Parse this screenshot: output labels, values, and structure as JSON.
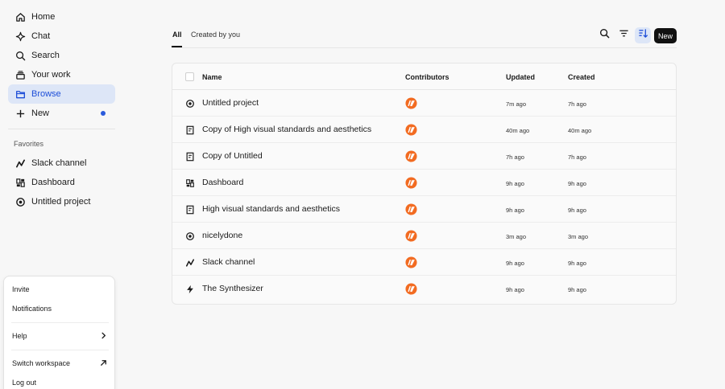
{
  "sidebar": {
    "nav": [
      {
        "label": "Home",
        "icon": "home-icon"
      },
      {
        "label": "Chat",
        "icon": "sparkle-icon"
      },
      {
        "label": "Search",
        "icon": "search-icon"
      },
      {
        "label": "Your work",
        "icon": "stack-icon"
      },
      {
        "label": "Browse",
        "icon": "folder-icon",
        "active": true
      },
      {
        "label": "New",
        "icon": "plus-icon",
        "has_dot": true
      }
    ],
    "favorites_heading": "Favorites",
    "favorites": [
      {
        "label": "Slack channel",
        "icon": "zigzag-icon"
      },
      {
        "label": "Dashboard",
        "icon": "dashboard-icon"
      },
      {
        "label": "Untitled project",
        "icon": "target-icon"
      }
    ]
  },
  "popup_menu": {
    "items": [
      {
        "label": "Invite"
      },
      {
        "label": "Notifications"
      },
      {
        "label": "Help",
        "trailing_icon": "chevron-right-icon"
      },
      {
        "label": "Switch workspace",
        "trailing_icon": "arrow-up-right-icon"
      },
      {
        "label": "Log out"
      }
    ]
  },
  "tabs": [
    {
      "label": "All",
      "active": true
    },
    {
      "label": "Created by you"
    }
  ],
  "toolbar": {
    "search_icon": "search-icon",
    "filter_icon": "filter-icon",
    "sort_icon": "sort-icon",
    "new_label": "New"
  },
  "table": {
    "headers": {
      "name": "Name",
      "contributors": "Contributors",
      "updated": "Updated",
      "created": "Created"
    },
    "rows": [
      {
        "icon": "target-icon",
        "name": "Untitled project",
        "updated": "7m ago",
        "created": "7h ago"
      },
      {
        "icon": "document-icon",
        "name": "Copy of High visual standards and aesthetics",
        "updated": "40m ago",
        "created": "40m ago"
      },
      {
        "icon": "document-icon",
        "name": "Copy of Untitled",
        "updated": "7h ago",
        "created": "7h ago"
      },
      {
        "icon": "dashboard-icon",
        "name": "Dashboard",
        "updated": "9h ago",
        "created": "9h ago"
      },
      {
        "icon": "document-icon",
        "name": "High visual standards and aesthetics",
        "updated": "9h ago",
        "created": "9h ago"
      },
      {
        "icon": "target-icon",
        "name": "nicelydone",
        "updated": "3m ago",
        "created": "3m ago"
      },
      {
        "icon": "zigzag-icon",
        "name": "Slack channel",
        "updated": "9h ago",
        "created": "9h ago"
      },
      {
        "icon": "bolt-icon",
        "name": "The Synthesizer",
        "updated": "9h ago",
        "created": "9h ago"
      }
    ]
  },
  "colors": {
    "accent": "#2b5bdc",
    "active_bg": "#dde6f7",
    "avatar": "#f26b21",
    "new_button": "#111111"
  }
}
